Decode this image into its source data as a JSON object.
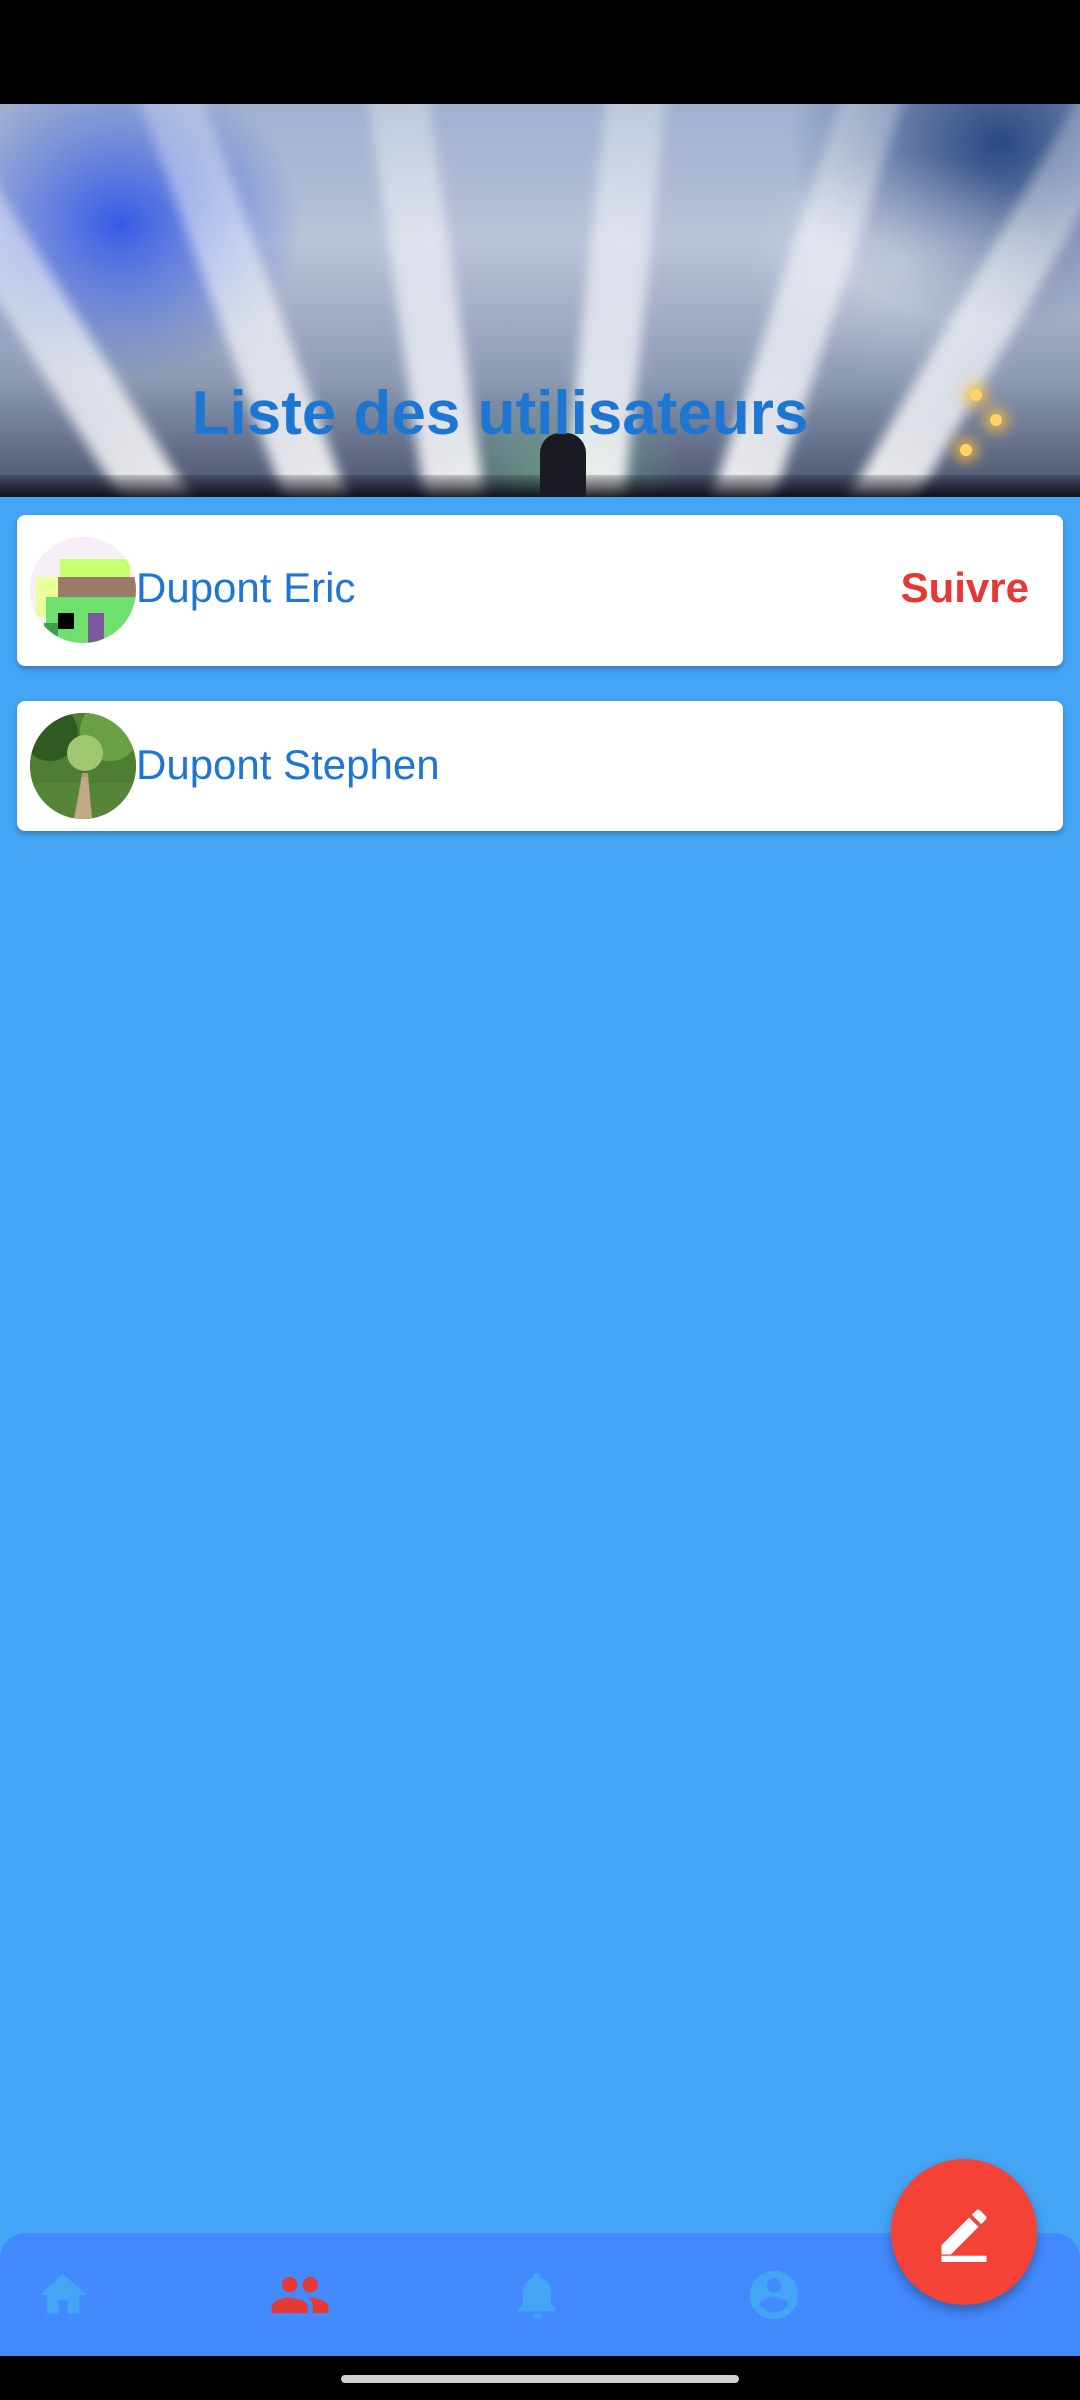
{
  "header": {
    "title": "Liste des utilisateurs"
  },
  "users": [
    {
      "name": "Dupont Eric",
      "action_label": "Suivre"
    },
    {
      "name": "Dupont Stephen"
    }
  ],
  "bottom_nav": {
    "items": [
      {
        "icon": "home-icon",
        "active": false
      },
      {
        "icon": "group-icon",
        "active": true
      },
      {
        "icon": "bell-icon",
        "active": false
      },
      {
        "icon": "account-circle-icon",
        "active": false
      }
    ],
    "active_color": "#e53935",
    "inactive_color": "#45a5f5"
  },
  "fab": {
    "icon": "edit-icon"
  },
  "colors": {
    "background": "#45a5f5",
    "accent": "#f44336",
    "text_primary": "#1d76d2",
    "bottom_nav_background": "#448aff"
  }
}
